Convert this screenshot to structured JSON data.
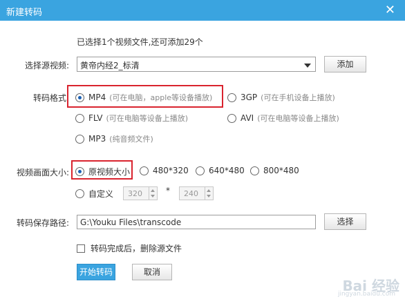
{
  "window": {
    "title": "新建转码"
  },
  "info": "已选择1个视频文件,还可添加29个",
  "source": {
    "label": "选择源视频:",
    "value": "黄帝内经2_标清",
    "add_label": "添加"
  },
  "format": {
    "label": "转码格式:",
    "options": [
      {
        "name": "MP4",
        "desc": "(可在电脑，apple等设备播放)",
        "selected": true
      },
      {
        "name": "3GP",
        "desc": "(可在手机设备上播放)",
        "selected": false
      },
      {
        "name": "FLV",
        "desc": "(可在电脑等设备上播放)",
        "selected": false
      },
      {
        "name": "AVI",
        "desc": "(可在电脑等设备上播放)",
        "selected": false
      },
      {
        "name": "MP3",
        "desc": "(纯音频文件)",
        "selected": false
      }
    ]
  },
  "size": {
    "label": "视频画面大小:",
    "options": [
      "原视频大小",
      "480*320",
      "640*480",
      "800*480"
    ],
    "custom_label": "自定义",
    "width": "320",
    "times": "*",
    "height": "240"
  },
  "path": {
    "label": "转码保存路径:",
    "value": "G:\\Youku Files\\transcode",
    "choose_label": "选择"
  },
  "delete_source": {
    "label": "转码完成后，删除源文件",
    "checked": false
  },
  "buttons": {
    "start": "开始转码",
    "cancel": "取消"
  },
  "watermark": {
    "brand": "Bai 经验",
    "url": "jingyan.baidu.com"
  },
  "colors": {
    "titlebar": "#3aa4e0",
    "highlight": "#d9232e"
  }
}
